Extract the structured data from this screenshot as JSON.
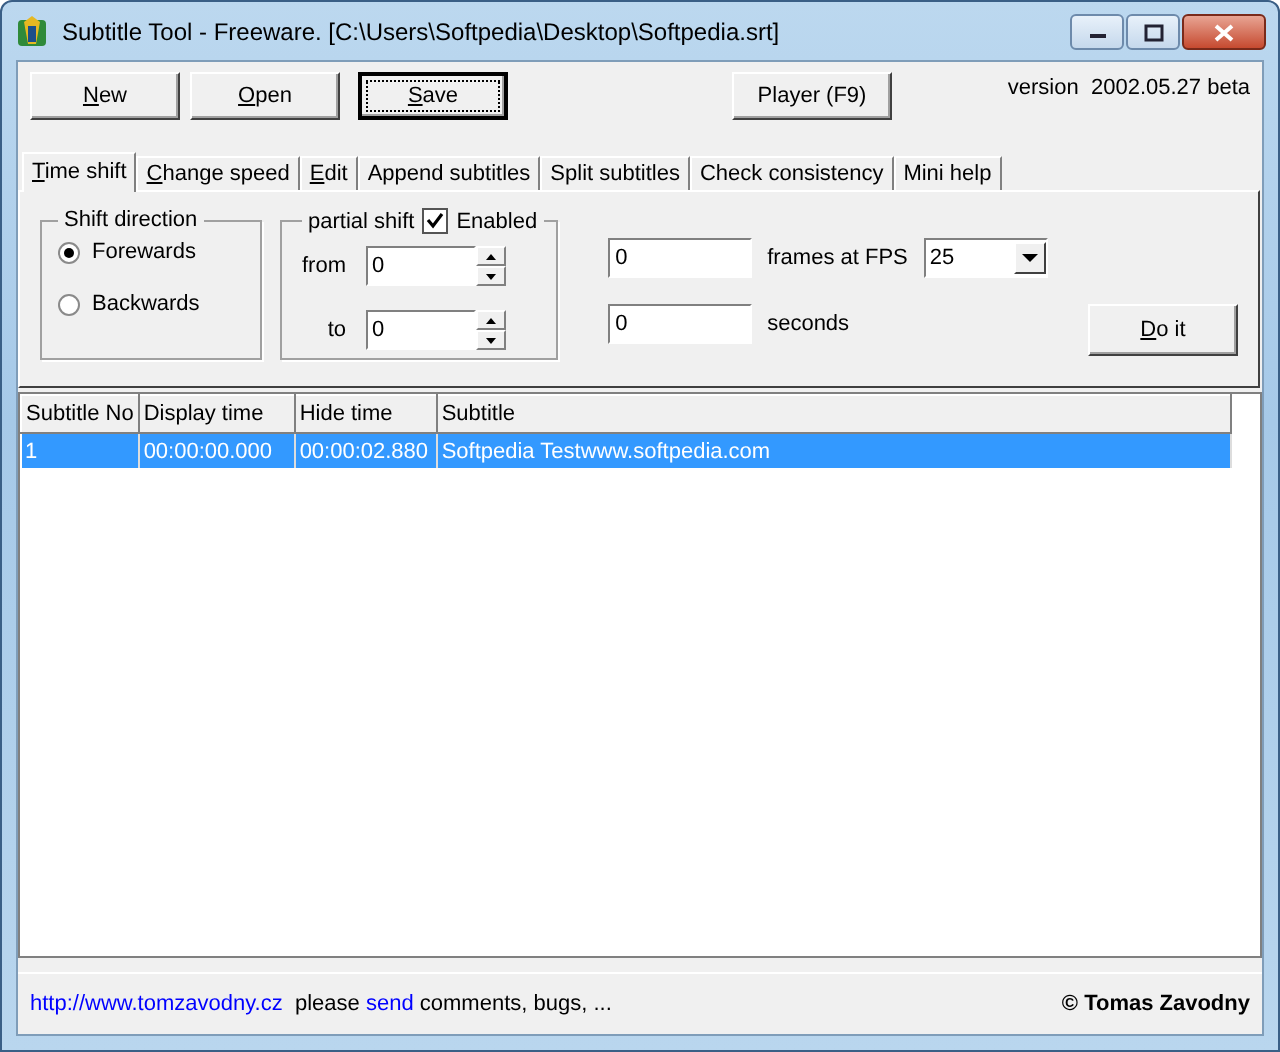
{
  "window": {
    "title": "Subtitle Tool - Freeware. [C:\\Users\\Softpedia\\Desktop\\Softpedia.srt]"
  },
  "toolbar": {
    "buttons": [
      {
        "label": "New",
        "mnemonic": true,
        "focused": false
      },
      {
        "label": "Open",
        "mnemonic": true,
        "focused": false
      },
      {
        "label": "Save",
        "mnemonic": true,
        "focused": true
      }
    ],
    "player_button": "Player (F9)",
    "version": "version  2002.05.27 beta"
  },
  "tabs": [
    {
      "label": "Time shift",
      "mnemonic": true,
      "selected": true
    },
    {
      "label": "Change speed",
      "mnemonic": true,
      "selected": false
    },
    {
      "label": "Edit",
      "mnemonic": true,
      "selected": false
    },
    {
      "label": "Append subtitles",
      "mnemonic": false,
      "selected": false
    },
    {
      "label": "Split subtitles",
      "mnemonic": false,
      "selected": false
    },
    {
      "label": "Check consistency",
      "mnemonic": false,
      "selected": false
    },
    {
      "label": "Mini help",
      "mnemonic": false,
      "selected": false
    }
  ],
  "shift_direction": {
    "title": "Shift direction",
    "options": [
      {
        "label": "Forewards",
        "selected": true
      },
      {
        "label": "Backwards",
        "selected": false
      }
    ]
  },
  "partial_shift": {
    "title": "partial shift",
    "enabled_label": "Enabled",
    "checked": true,
    "from_label": "from",
    "from_value": "0",
    "to_label": "to",
    "to_value": "0"
  },
  "frames": {
    "value": "0",
    "label": "frames at FPS",
    "fps": "25"
  },
  "seconds": {
    "value": "0",
    "label": "seconds"
  },
  "do_it_button": {
    "label": "Do it",
    "mnemonic": true
  },
  "table": {
    "columns": [
      "Subtitle No",
      "Display time",
      "Hide time",
      "Subtitle"
    ],
    "rows": [
      {
        "cells": [
          "1",
          "00:00:00.000",
          "00:00:02.880",
          "Softpedia Testwww.softpedia.com"
        ],
        "selected": true
      }
    ]
  },
  "footer": {
    "link": "http://www.tomzavodny.cz",
    "please": "please",
    "send_link": "send",
    "rest": "comments, bugs, ...",
    "copyright": "© Tomas Zavodny"
  }
}
